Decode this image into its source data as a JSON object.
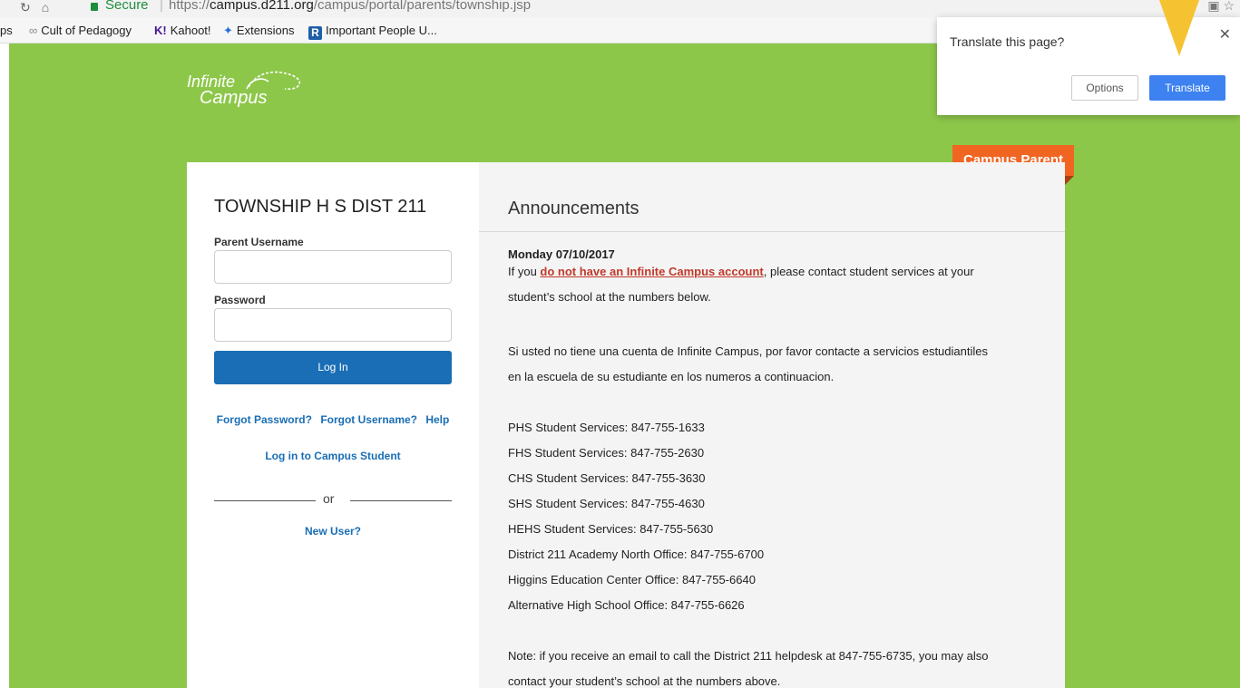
{
  "browser": {
    "secure_label": "Secure",
    "url_prefix": "https://",
    "url_host": "campus.d211.org",
    "url_path": "/campus/portal/parents/township.jsp",
    "bookmarks": [
      {
        "icon": "apps-icon",
        "label": "ps"
      },
      {
        "icon": "infinity-icon",
        "label": "Cult of Pedagogy"
      },
      {
        "icon": "kahoot-icon",
        "label": "Kahoot!"
      },
      {
        "icon": "puzzle-icon",
        "label": "Extensions"
      },
      {
        "icon": "r-logo-icon",
        "label": "Important People U..."
      }
    ]
  },
  "translate_popup": {
    "title": "Translate this page?",
    "options_label": "Options",
    "translate_label": "Translate"
  },
  "logo": {
    "line1": "Infinite",
    "line2": "Campus"
  },
  "ribbon": {
    "label": "Campus Parent"
  },
  "login": {
    "district": "TOWNSHIP H S DIST 211",
    "username_label": "Parent Username",
    "password_label": "Password",
    "login_button": "Log In",
    "forgot_password": "Forgot Password?",
    "forgot_username": "Forgot Username?",
    "help": "Help",
    "student_link": "Log in to Campus Student",
    "or": "or",
    "new_user": "New User?"
  },
  "announcements": {
    "title": "Announcements",
    "date": "Monday 07/10/2017",
    "intro_prefix": "If you ",
    "intro_link": "do not have an Infinite Campus account",
    "intro_suffix": ", please contact student services at your",
    "intro_line2": "student’s school at the numbers below.",
    "spanish_line1": "Si usted no tiene una cuenta de Infinite Campus, por favor contacte a servicios estudiantiles",
    "spanish_line2": "en la escuela de su estudiante en los numeros a continuacion.",
    "contacts": [
      "PHS Student Services: 847-755-1633",
      "FHS Student Services: 847-755-2630",
      "CHS Student Services: 847-755-3630",
      "SHS Student Services: 847-755-4630",
      "HEHS Student Services: 847-755-5630",
      "District 211 Academy North Office: 847-755-6700",
      "Higgins Education Center Office: 847-755-6640",
      "Alternative High School Office: 847-755-6626"
    ],
    "note_line1": "Note: if you receive an email to call the District 211 helpdesk at 847-755-6735, you may also",
    "note_line2": "contact your student’s school at the numbers above."
  },
  "colors": {
    "page_background": "#8dc74a",
    "primary_button": "#1a6eb5",
    "ribbon": "#f16522",
    "link_red": "#c0392b",
    "translate_button": "#3d82f0"
  }
}
